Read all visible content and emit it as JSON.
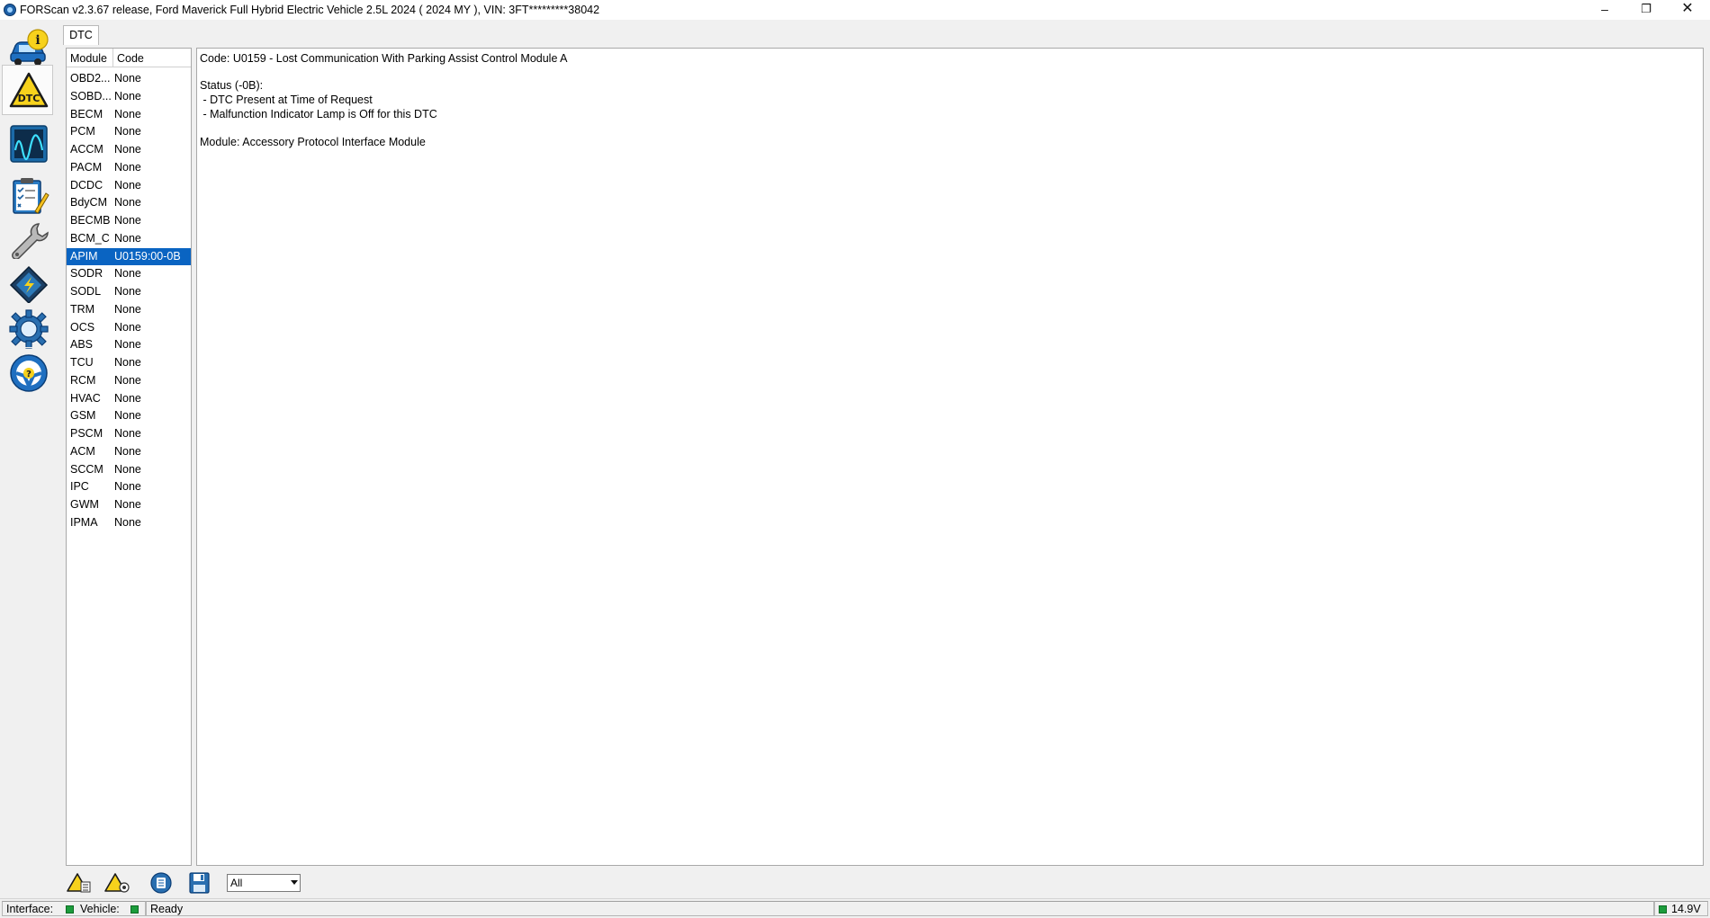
{
  "window": {
    "title": "FORScan v2.3.67 release, Ford Maverick Full Hybrid Electric Vehicle 2.5L 2024 ( 2024 MY ), VIN: 3FT*********38042",
    "minimize": "–",
    "maximize": "❐",
    "close": "✕"
  },
  "sidebar": {
    "items": [
      {
        "name": "vehicle-info",
        "icon": "car-info-icon"
      },
      {
        "name": "dtc",
        "icon": "dtc-warning-icon",
        "label": "DTC",
        "active": true
      },
      {
        "name": "oscilloscope",
        "icon": "oscilloscope-icon"
      },
      {
        "name": "tests",
        "icon": "checklist-icon"
      },
      {
        "name": "service",
        "icon": "wrench-icon"
      },
      {
        "name": "configuration",
        "icon": "chip-icon"
      },
      {
        "name": "settings",
        "icon": "gear-icon"
      },
      {
        "name": "help",
        "icon": "help-wheel-icon",
        "label": "?"
      }
    ]
  },
  "tabs": [
    {
      "label": "DTC"
    }
  ],
  "modules": {
    "headers": [
      "Module",
      "Code"
    ],
    "rows": [
      {
        "module": "OBD2...",
        "code": "None"
      },
      {
        "module": "SOBD...",
        "code": "None"
      },
      {
        "module": "BECM",
        "code": "None"
      },
      {
        "module": "PCM",
        "code": "None"
      },
      {
        "module": "ACCM",
        "code": "None"
      },
      {
        "module": "PACM",
        "code": "None"
      },
      {
        "module": "DCDC",
        "code": "None"
      },
      {
        "module": "BdyCM",
        "code": "None"
      },
      {
        "module": "BECMB",
        "code": "None"
      },
      {
        "module": "BCM_C",
        "code": "None"
      },
      {
        "module": "APIM",
        "code": "U0159:00-0B",
        "selected": true
      },
      {
        "module": "SODR",
        "code": "None"
      },
      {
        "module": "SODL",
        "code": "None"
      },
      {
        "module": "TRM",
        "code": "None"
      },
      {
        "module": "OCS",
        "code": "None"
      },
      {
        "module": "ABS",
        "code": "None"
      },
      {
        "module": "TCU",
        "code": "None"
      },
      {
        "module": "RCM",
        "code": "None"
      },
      {
        "module": "HVAC",
        "code": "None"
      },
      {
        "module": "GSM",
        "code": "None"
      },
      {
        "module": "PSCM",
        "code": "None"
      },
      {
        "module": "ACM",
        "code": "None"
      },
      {
        "module": "SCCM",
        "code": "None"
      },
      {
        "module": "IPC",
        "code": "None"
      },
      {
        "module": "GWM",
        "code": "None"
      },
      {
        "module": "IPMA",
        "code": "None"
      }
    ]
  },
  "detail": {
    "code_line": "Code: U0159 - Lost Communication With Parking Assist Control Module A",
    "status_line": "Status (-0B):",
    "status_items": [
      " - DTC Present at Time of Request",
      " - Malfunction Indicator Lamp is Off for this DTC"
    ],
    "module_line": "Module: Accessory Protocol Interface Module"
  },
  "toolbar": {
    "buttons": [
      {
        "name": "read-dtc-button",
        "icon": "warning-read-icon"
      },
      {
        "name": "clear-dtc-button",
        "icon": "warning-clear-icon"
      },
      {
        "name": "clear-all-button",
        "icon": "erase-icon"
      },
      {
        "name": "save-button",
        "icon": "floppy-icon"
      }
    ],
    "filter_value": "All"
  },
  "status": {
    "interface_label": "Interface:",
    "vehicle_label": "Vehicle:",
    "state": "Ready",
    "voltage": "14.9V",
    "led_color": "#1c9c3c"
  }
}
